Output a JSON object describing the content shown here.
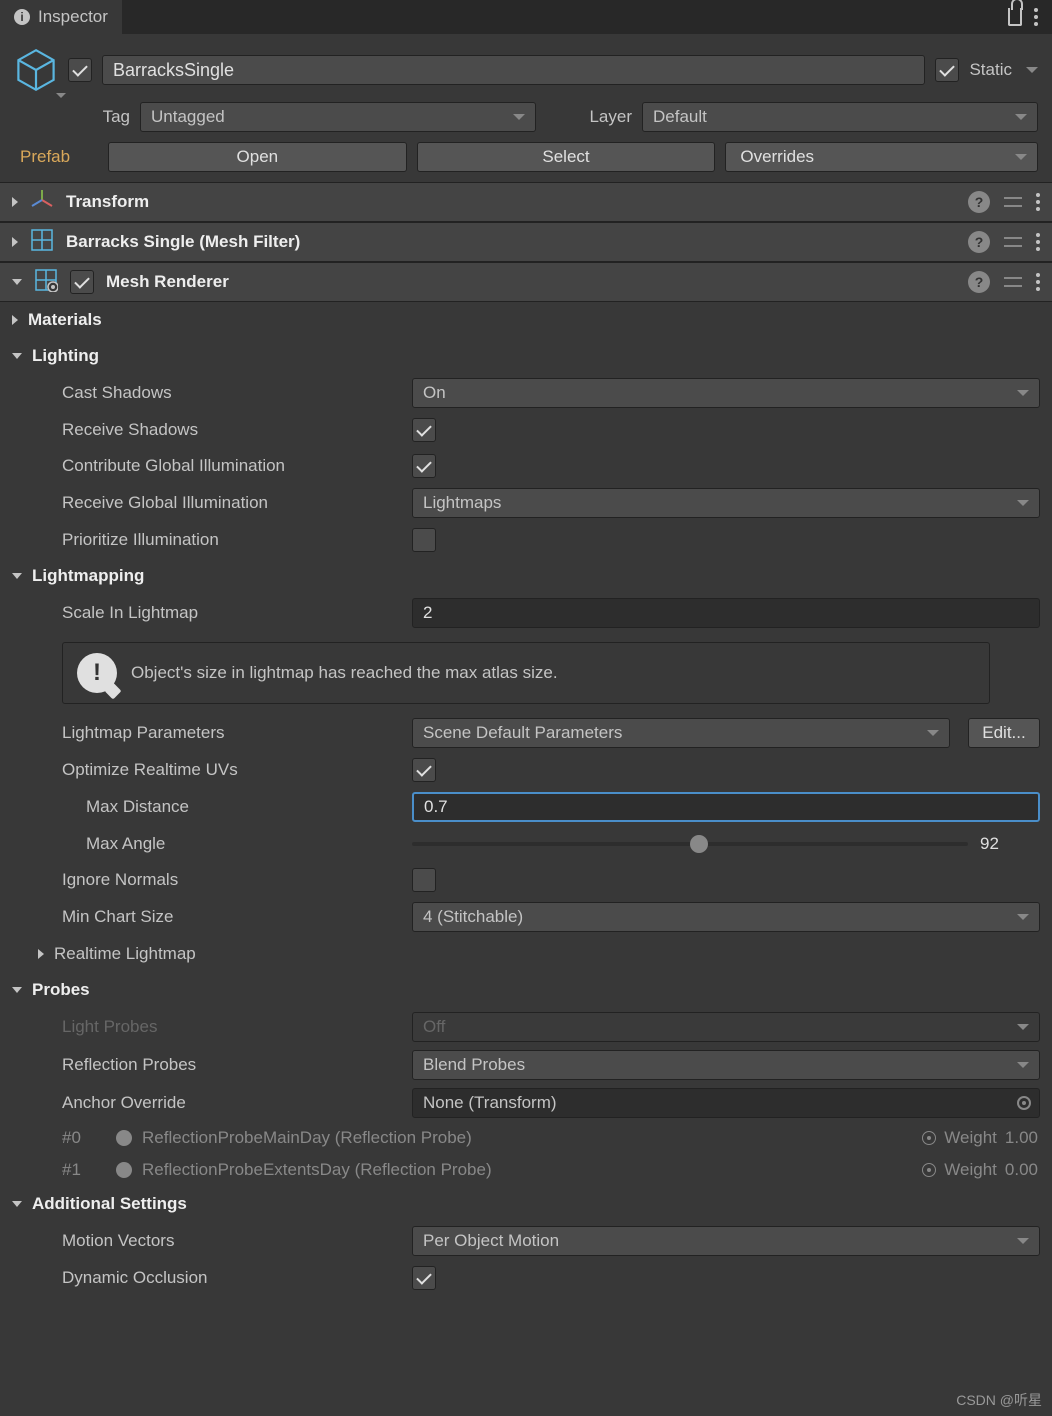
{
  "tab": {
    "title": "Inspector"
  },
  "header": {
    "active": true,
    "name": "BarracksSingle",
    "static_label": "Static",
    "static": true,
    "tag_label": "Tag",
    "tag_value": "Untagged",
    "layer_label": "Layer",
    "layer_value": "Default",
    "prefab_label": "Prefab",
    "open_button": "Open",
    "select_button": "Select",
    "overrides_button": "Overrides"
  },
  "components": {
    "transform": {
      "title": "Transform"
    },
    "mesh_filter": {
      "title": "Barracks Single (Mesh Filter)"
    },
    "mesh_renderer": {
      "title": "Mesh Renderer",
      "enabled": true
    }
  },
  "mesh_renderer": {
    "materials_header": "Materials",
    "lighting_header": "Lighting",
    "lighting": {
      "cast_shadows": {
        "label": "Cast Shadows",
        "value": "On"
      },
      "receive_shadows": {
        "label": "Receive Shadows",
        "value": true
      },
      "contribute_gi": {
        "label": "Contribute Global Illumination",
        "value": true
      },
      "receive_gi": {
        "label": "Receive Global Illumination",
        "value": "Lightmaps"
      },
      "prioritize": {
        "label": "Prioritize Illumination",
        "value": false
      }
    },
    "lightmapping_header": "Lightmapping",
    "lightmapping": {
      "scale": {
        "label": "Scale In Lightmap",
        "value": "2"
      },
      "warning": "Object's size in lightmap has reached the max atlas size.",
      "parameters": {
        "label": "Lightmap Parameters",
        "value": "Scene Default Parameters",
        "edit": "Edit..."
      },
      "optimize_uvs": {
        "label": "Optimize Realtime UVs",
        "value": true
      },
      "max_distance": {
        "label": "Max Distance",
        "value": "0.7"
      },
      "max_angle": {
        "label": "Max Angle",
        "value": "92",
        "slider_percent": 50
      },
      "ignore_normals": {
        "label": "Ignore Normals",
        "value": false
      },
      "min_chart": {
        "label": "Min Chart Size",
        "value": "4 (Stitchable)"
      },
      "realtime_lightmap": "Realtime Lightmap"
    },
    "probes_header": "Probes",
    "probes": {
      "light_probes": {
        "label": "Light Probes",
        "value": "Off"
      },
      "reflection_probes": {
        "label": "Reflection Probes",
        "value": "Blend Probes"
      },
      "anchor_override": {
        "label": "Anchor Override",
        "value": "None (Transform)"
      },
      "list": [
        {
          "idx": "#0",
          "name": "ReflectionProbeMainDay (Reflection Probe)",
          "weight_label": "Weight",
          "weight": "1.00"
        },
        {
          "idx": "#1",
          "name": "ReflectionProbeExtentsDay (Reflection Probe)",
          "weight_label": "Weight",
          "weight": "0.00"
        }
      ]
    },
    "additional_header": "Additional Settings",
    "additional": {
      "motion_vectors": {
        "label": "Motion Vectors",
        "value": "Per Object Motion"
      },
      "dynamic_occlusion": {
        "label": "Dynamic Occlusion",
        "value": true
      }
    }
  },
  "watermark": "CSDN @听星"
}
